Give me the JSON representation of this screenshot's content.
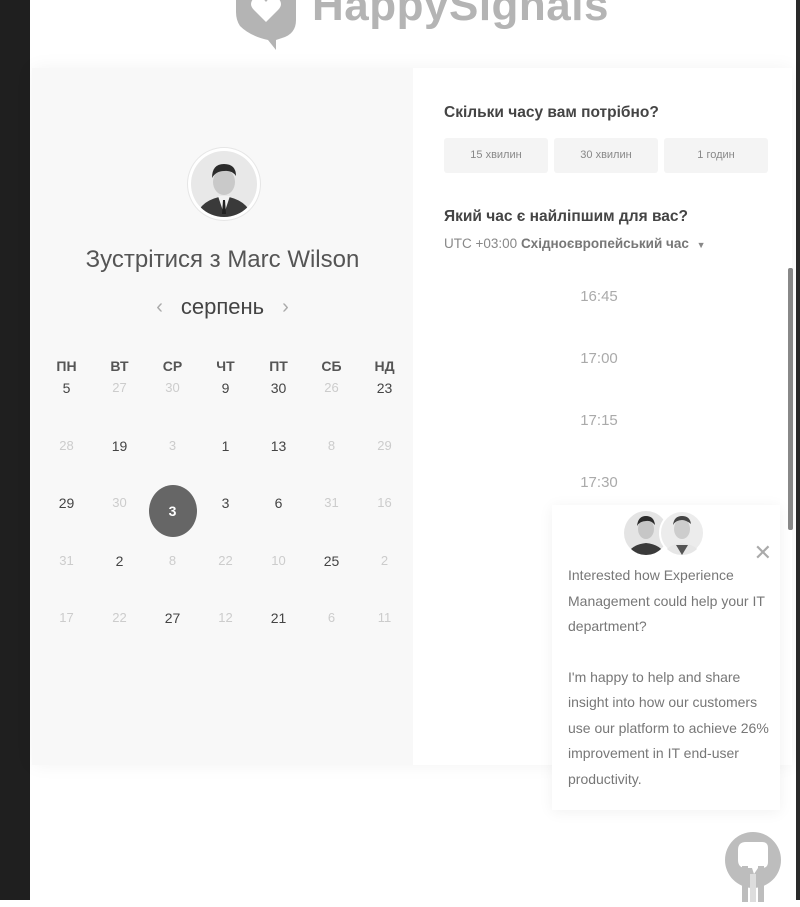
{
  "brand": {
    "name": "HappySignals"
  },
  "host": {
    "prefix": "Зустрітися з",
    "name": "Marc Wilson"
  },
  "calendar": {
    "month": "серпень",
    "prev_icon": "chevron-left-icon",
    "next_icon": "chevron-right-icon",
    "weekdays": [
      "ПН",
      "ВТ",
      "СР",
      "ЧТ",
      "ПТ",
      "СБ",
      "НД"
    ],
    "weeks": [
      [
        {
          "d": "5",
          "muted": false
        },
        {
          "d": "27",
          "muted": true
        },
        {
          "d": "30",
          "muted": true
        },
        {
          "d": "9",
          "muted": false
        },
        {
          "d": "30",
          "muted": false
        },
        {
          "d": "26",
          "muted": true
        },
        {
          "d": "23",
          "muted": false
        }
      ],
      [
        {
          "d": "28",
          "muted": true
        },
        {
          "d": "19",
          "muted": false
        },
        {
          "d": "3",
          "muted": true
        },
        {
          "d": "1",
          "muted": false
        },
        {
          "d": "13",
          "muted": false
        },
        {
          "d": "8",
          "muted": true
        },
        {
          "d": "29",
          "muted": true
        }
      ],
      [
        {
          "d": "29",
          "muted": false
        },
        {
          "d": "30",
          "muted": true
        },
        {
          "d": "3",
          "muted": false,
          "selected": true
        },
        {
          "d": "3",
          "muted": false
        },
        {
          "d": "6",
          "muted": false
        },
        {
          "d": "31",
          "muted": true
        },
        {
          "d": "16",
          "muted": true
        }
      ],
      [
        {
          "d": "31",
          "muted": true
        },
        {
          "d": "2",
          "muted": false
        },
        {
          "d": "8",
          "muted": true
        },
        {
          "d": "22",
          "muted": true
        },
        {
          "d": "10",
          "muted": true
        },
        {
          "d": "25",
          "muted": false
        },
        {
          "d": "2",
          "muted": true
        }
      ],
      [
        {
          "d": "17",
          "muted": true
        },
        {
          "d": "22",
          "muted": true
        },
        {
          "d": "27",
          "muted": false
        },
        {
          "d": "12",
          "muted": true
        },
        {
          "d": "21",
          "muted": false
        },
        {
          "d": "6",
          "muted": true
        },
        {
          "d": "11",
          "muted": true
        }
      ]
    ]
  },
  "duration": {
    "question": "Скільки часу вам потрібно?",
    "options": [
      "15 хвилин",
      "30 хвилин",
      "1 годин"
    ]
  },
  "timepick": {
    "question": "Який час є найліпшим для вас?",
    "tz_offset": "UTC +03:00",
    "tz_name": "Східноєвропейський час",
    "slots": [
      "16:45",
      "17:00",
      "17:15",
      "17:30"
    ]
  },
  "chat": {
    "message_1": "Interested how Experience Management could help your IT department?",
    "message_2": "I'm happy to help and share insight into how our customers use our platform to achieve 26% improvement in IT end-user productivity.",
    "close_icon": "close-icon"
  },
  "colors": {
    "selected_day": "#666666",
    "scrollbar": "#888888",
    "sidebar_dark": "#1f1f1f"
  }
}
